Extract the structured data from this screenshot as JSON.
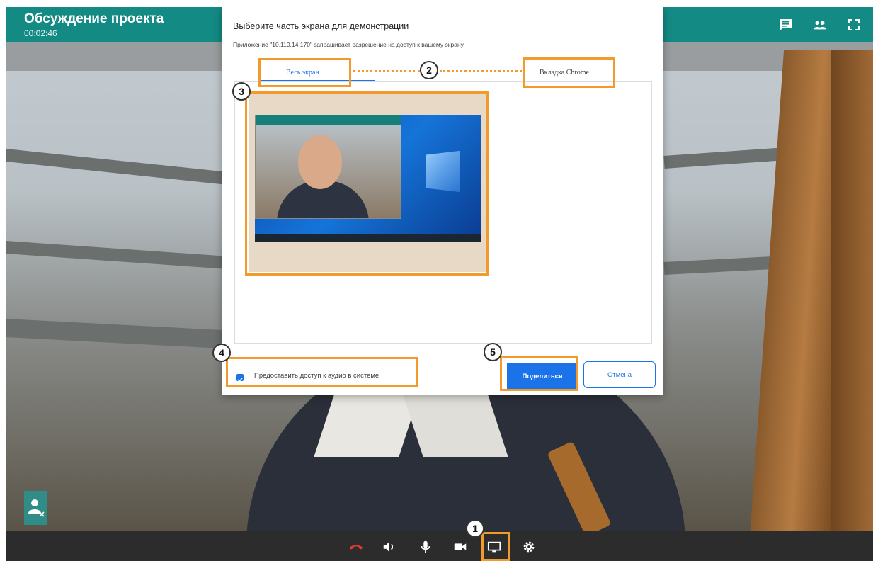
{
  "conference": {
    "title": "Обсуждение проекта",
    "timer": "00:02:46"
  },
  "header_icons": [
    "chat-icon",
    "participants-icon",
    "fullscreen-icon"
  ],
  "dialog": {
    "title": "Выберите часть экрана для демонстрации",
    "subtitle": "Приложение \"10.110.14.170\" запрашивает разрешение на доступ к вашему экрану.",
    "tabs": [
      {
        "label": "Весь экран",
        "active": true
      },
      {
        "label": "Вкладка Chrome",
        "active": false
      }
    ],
    "audio_checkbox": {
      "label": "Предоставить доступ к аудио в системе",
      "checked": true
    },
    "share_button": "Поделиться",
    "cancel_button": "Отмена"
  },
  "toolbar_icons": [
    "hangup-icon",
    "volume-icon",
    "microphone-icon",
    "camera-icon",
    "screen-share-icon",
    "settings-icon"
  ],
  "annotations": [
    "1",
    "2",
    "3",
    "4",
    "5"
  ],
  "colors": {
    "header": "#148a84",
    "toolbar": "#2c2c2c",
    "accent": "#1a73e8",
    "highlight": "#f39a2c",
    "hangup": "#e53935"
  }
}
